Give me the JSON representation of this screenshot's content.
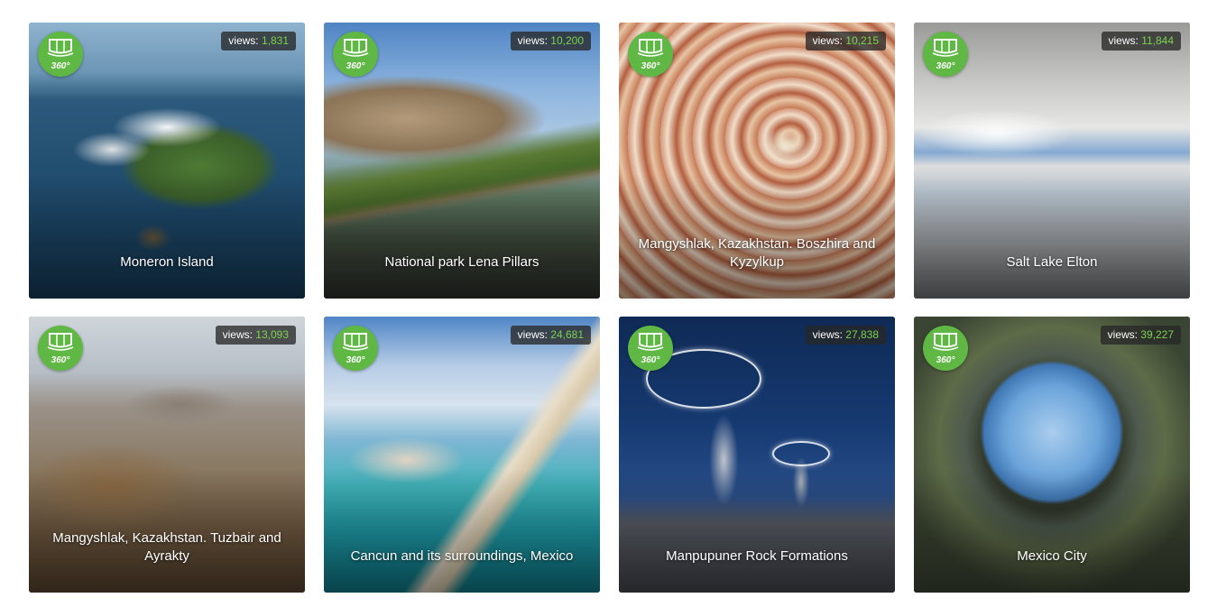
{
  "badge_text": "360°",
  "views_label": "views:",
  "colors": {
    "badge": "#5fb744",
    "views_number": "#7bd34f"
  },
  "cards": [
    {
      "title": "Moneron Island",
      "views": "1,831"
    },
    {
      "title": "National park Lena Pillars",
      "views": "10,200"
    },
    {
      "title": "Mangyshlak, Kazakhstan. Boszhira and Kyzylkup",
      "views": "10,215"
    },
    {
      "title": "Salt Lake Elton",
      "views": "11,844"
    },
    {
      "title": "Mangyshlak, Kazakhstan. Tuzbair and Ayrakty",
      "views": "13,093"
    },
    {
      "title": "Cancun and its surroundings, Mexico",
      "views": "24,681"
    },
    {
      "title": "Manpupuner Rock Formations",
      "views": "27,838"
    },
    {
      "title": "Mexico City",
      "views": "39,227"
    }
  ]
}
